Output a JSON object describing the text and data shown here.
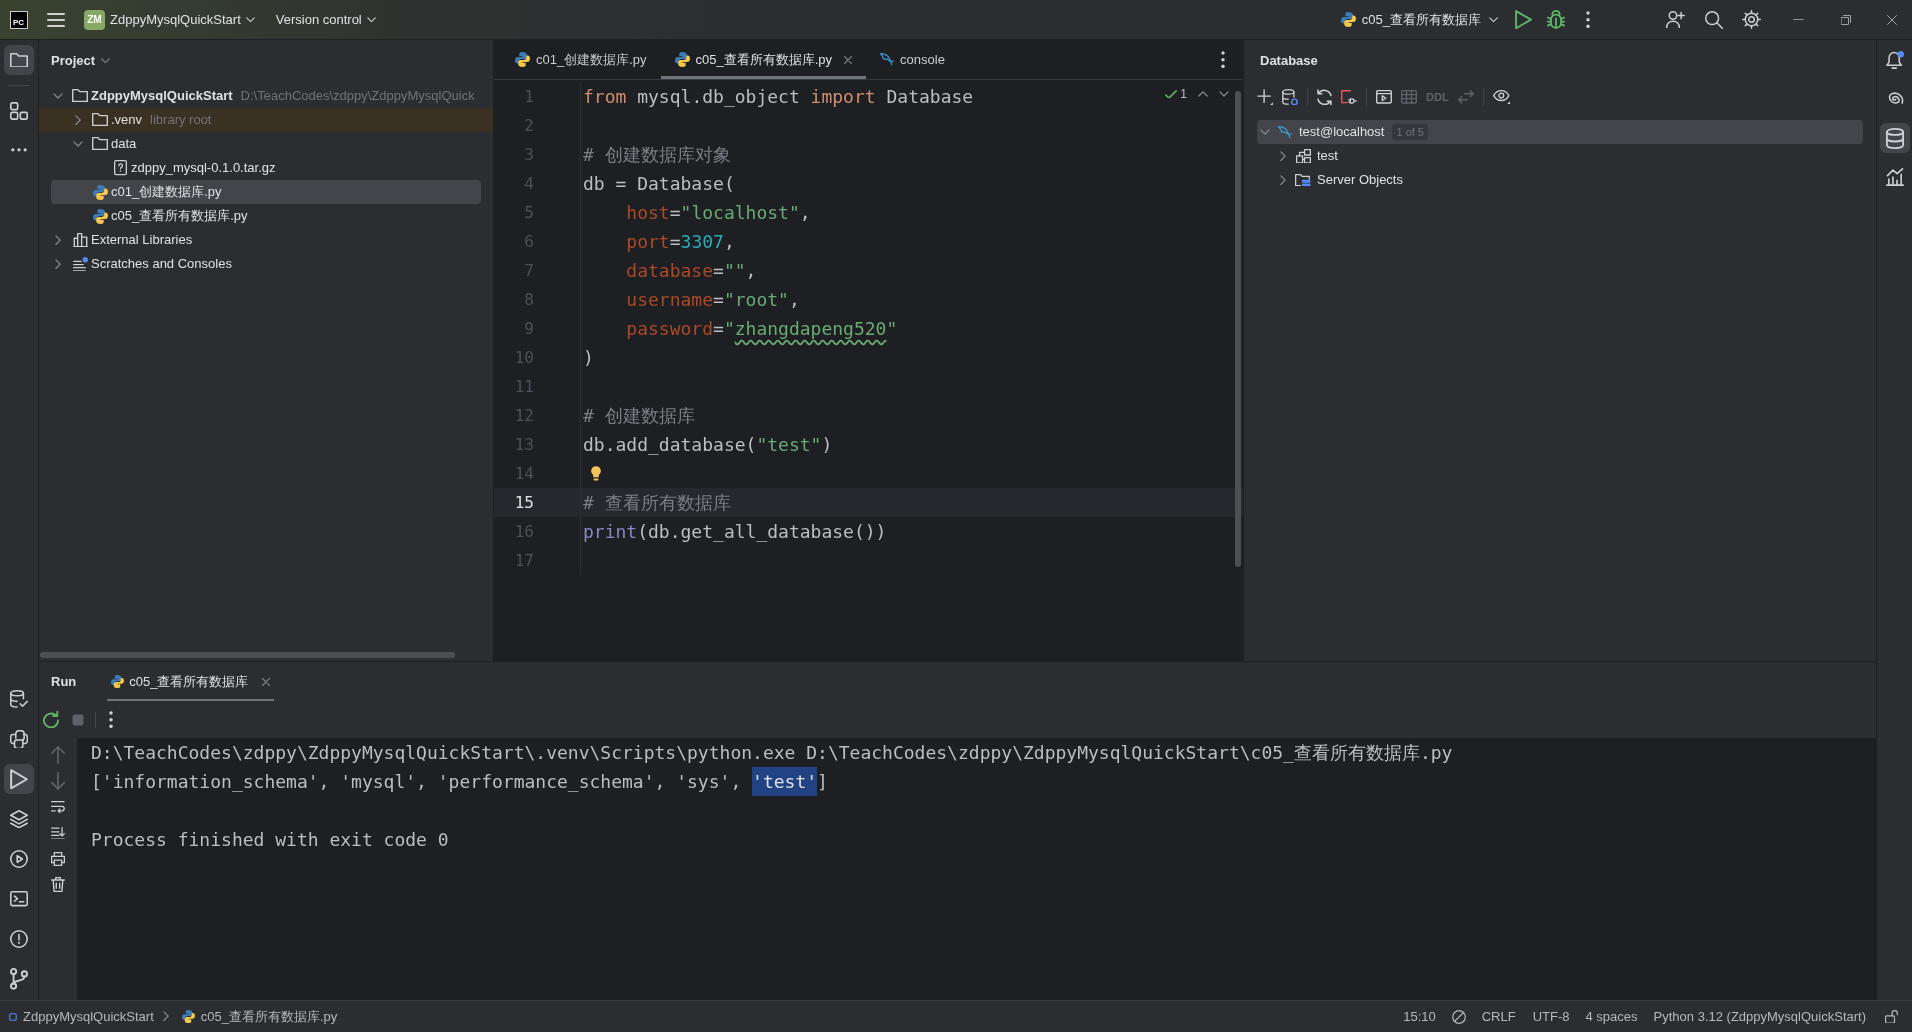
{
  "title_bar": {
    "logo": "PC",
    "project_badge": "ZM",
    "project": "ZdppyMysqlQuickStart",
    "vcs": "Version control",
    "run_configuration": "c05_查看所有数据库"
  },
  "left_toolbar": {
    "top": [
      {
        "kind": "project",
        "selected": true
      },
      {
        "kind": "structure",
        "selected": false
      },
      {
        "kind": "more",
        "selected": false
      }
    ],
    "bottom": [
      {
        "kind": "db_changes",
        "selected": false
      },
      {
        "kind": "console",
        "selected": false
      },
      {
        "kind": "run",
        "selected": true
      },
      {
        "kind": "layers",
        "selected": false
      },
      {
        "kind": "services",
        "selected": false
      },
      {
        "kind": "terminal",
        "selected": false
      },
      {
        "kind": "problems",
        "selected": false
      },
      {
        "kind": "git",
        "selected": false
      }
    ]
  },
  "project_panel": {
    "title": "Project",
    "tree": [
      {
        "kind": "folder",
        "name": "ZdppyMysqlQuickStart",
        "hint": "D:\\TeachCodes\\zdppy\\ZdppyMysqlQuick",
        "expanded": true,
        "selected": false,
        "highlighted": false,
        "children": [
          {
            "kind": "folder",
            "name": ".venv",
            "hint": "library root",
            "expanded": false,
            "selected": false,
            "highlighted": true
          },
          {
            "kind": "folder",
            "name": "data",
            "expanded": true,
            "selected": false,
            "highlighted": false,
            "children": [
              {
                "kind": "archive",
                "name": "zdppy_mysql-0.1.0.tar.gz",
                "selected": false,
                "highlighted": false
              }
            ]
          },
          {
            "kind": "python",
            "name": "c01_创建数据库.py",
            "selected": true,
            "highlighted": false
          },
          {
            "kind": "python",
            "name": "c05_查看所有数据库.py",
            "selected": false,
            "highlighted": false
          }
        ]
      },
      {
        "kind": "libraries",
        "name": "External Libraries",
        "expanded": false,
        "selected": false,
        "highlighted": false
      },
      {
        "kind": "scratches",
        "name": "Scratches and Consoles",
        "expanded": false,
        "selected": false,
        "highlighted": false
      }
    ]
  },
  "editor": {
    "tabs": [
      {
        "kind": "python",
        "label": "c01_创建数据库.py",
        "selected": false
      },
      {
        "kind": "python",
        "label": "c05_查看所有数据库.py",
        "selected": true
      },
      {
        "kind": "console",
        "label": "console",
        "selected": false
      }
    ],
    "problems": "1",
    "lines": [
      {
        "number": "1",
        "current": false,
        "tokens": [
          {
            "kind": "keyword",
            "text": "from"
          },
          {
            "kind": "plain",
            "text": " mysql.db_object "
          },
          {
            "kind": "keyword",
            "text": "import"
          },
          {
            "kind": "plain",
            "text": " Database"
          }
        ]
      },
      {
        "number": "2",
        "current": false
      },
      {
        "number": "3",
        "current": false,
        "tokens": [
          {
            "kind": "comment",
            "text": "# 创建数据库对象"
          }
        ]
      },
      {
        "number": "4",
        "current": false,
        "tokens": [
          {
            "kind": "plain",
            "text": "db = Database("
          }
        ]
      },
      {
        "number": "5",
        "current": false,
        "tokens": [
          {
            "kind": "kwarg",
            "text": "    host"
          },
          {
            "kind": "plain",
            "text": "="
          },
          {
            "kind": "string",
            "text": "\"localhost\""
          },
          {
            "kind": "plain",
            "text": ","
          }
        ]
      },
      {
        "number": "6",
        "current": false,
        "tokens": [
          {
            "kind": "kwarg",
            "text": "    port"
          },
          {
            "kind": "plain",
            "text": "="
          },
          {
            "kind": "number",
            "text": "3307"
          },
          {
            "kind": "plain",
            "text": ","
          }
        ]
      },
      {
        "number": "7",
        "current": false,
        "tokens": [
          {
            "kind": "kwarg",
            "text": "    database"
          },
          {
            "kind": "plain",
            "text": "="
          },
          {
            "kind": "string",
            "text": "\"\""
          },
          {
            "kind": "plain",
            "text": ","
          }
        ]
      },
      {
        "number": "8",
        "current": false,
        "tokens": [
          {
            "kind": "kwarg",
            "text": "    username"
          },
          {
            "kind": "plain",
            "text": "="
          },
          {
            "kind": "string",
            "text": "\"root\""
          },
          {
            "kind": "plain",
            "text": ","
          }
        ]
      },
      {
        "number": "9",
        "current": false,
        "tokens": [
          {
            "kind": "kwarg",
            "text": "    password"
          },
          {
            "kind": "plain",
            "text": "="
          },
          {
            "kind": "string",
            "text": "\""
          },
          {
            "kind": "string",
            "text": "zhangdapeng520",
            "typo": true
          },
          {
            "kind": "string",
            "text": "\""
          }
        ]
      },
      {
        "number": "10",
        "current": false,
        "tokens": [
          {
            "kind": "plain",
            "text": ")"
          }
        ]
      },
      {
        "number": "11",
        "current": false
      },
      {
        "number": "12",
        "current": false,
        "tokens": [
          {
            "kind": "comment",
            "text": "# 创建数据库"
          }
        ]
      },
      {
        "number": "13",
        "current": false,
        "tokens": [
          {
            "kind": "plain",
            "text": "db.add_database("
          },
          {
            "kind": "string",
            "text": "\"test\""
          },
          {
            "kind": "plain",
            "text": ")"
          }
        ]
      },
      {
        "number": "14",
        "current": false,
        "bulb": true
      },
      {
        "number": "15",
        "current": true,
        "tokens": [
          {
            "kind": "comment",
            "text": "# 查看所有数据库"
          }
        ]
      },
      {
        "number": "16",
        "current": false,
        "tokens": [
          {
            "kind": "builtin",
            "text": "print"
          },
          {
            "kind": "plain",
            "text": "(db.get_all_database())"
          }
        ]
      },
      {
        "number": "17",
        "current": false
      }
    ]
  },
  "database_panel": {
    "title": "Database",
    "toolbar": [
      {
        "kind": "add",
        "disabled": false
      },
      {
        "kind": "properties",
        "disabled": false
      },
      {
        "kind": "separator"
      },
      {
        "kind": "refresh",
        "disabled": false
      },
      {
        "kind": "disconnect",
        "disabled": false
      },
      {
        "kind": "separator"
      },
      {
        "kind": "console",
        "disabled": false
      },
      {
        "kind": "table",
        "disabled": true
      },
      {
        "kind": "ddl",
        "label": "DDL",
        "disabled": true
      },
      {
        "kind": "compare",
        "disabled": true
      },
      {
        "kind": "separator"
      },
      {
        "kind": "view",
        "disabled": false
      }
    ],
    "tree": [
      {
        "kind": "connection",
        "name": "test@localhost",
        "badge": "1 of 5",
        "expanded": true,
        "selected": true,
        "children": [
          {
            "kind": "schema",
            "name": "test",
            "expanded": false,
            "selected": false
          },
          {
            "kind": "server_objects",
            "name": "Server Objects",
            "expanded": false,
            "selected": false
          }
        ]
      }
    ]
  },
  "right_toolbar": [
    {
      "kind": "notifications",
      "selected": false,
      "unread": true
    },
    {
      "kind": "assistant",
      "selected": false
    },
    {
      "kind": "database",
      "selected": true
    },
    {
      "kind": "profiler",
      "selected": false
    }
  ],
  "run_panel": {
    "title": "Run",
    "tabs": [
      {
        "kind": "python",
        "label": "c05_查看所有数据库",
        "selected": true
      }
    ],
    "toolbar": [
      {
        "kind": "rerun",
        "disabled": false
      },
      {
        "kind": "stop",
        "disabled": true
      },
      {
        "kind": "more",
        "disabled": false
      }
    ],
    "side_toolbar": [
      {
        "kind": "up",
        "disabled": true
      },
      {
        "kind": "down",
        "disabled": true
      },
      {
        "kind": "wrap",
        "disabled": false
      },
      {
        "kind": "scroll_end",
        "disabled": false
      },
      {
        "kind": "print",
        "disabled": false
      },
      {
        "kind": "clear",
        "disabled": false
      }
    ],
    "output": [
      {
        "kind": "command",
        "segments": [
          {
            "text": "D:\\TeachCodes\\zdppy\\ZdppyMysqlQuickStart\\.venv\\Scripts\\python.exe D:\\TeachCodes\\zdppy\\ZdppyMysqlQuickStart\\c05_查看所有数据库.py",
            "selected": false
          }
        ]
      },
      {
        "kind": "stdout",
        "segments": [
          {
            "text": "['information_schema', 'mysql', 'performance_schema', 'sys', ",
            "selected": false
          },
          {
            "text": "'test'",
            "selected": true
          },
          {
            "text": "]",
            "selected": false
          }
        ]
      },
      {
        "kind": "exit",
        "segments": [
          {
            "text": "Process finished with exit code 0",
            "selected": false
          }
        ]
      }
    ]
  },
  "status_bar": {
    "breadcrumbs": [
      {
        "kind": "module",
        "label": "ZdppyMysqlQuickStart"
      },
      {
        "kind": "python",
        "label": "c05_查看所有数据库.py"
      }
    ],
    "caret": "15:10",
    "line_separator": "CRLF",
    "encoding": "UTF-8",
    "indent": "4 spaces",
    "interpreter": "Python 3.12 (ZdppyMysqlQuickStart)"
  }
}
